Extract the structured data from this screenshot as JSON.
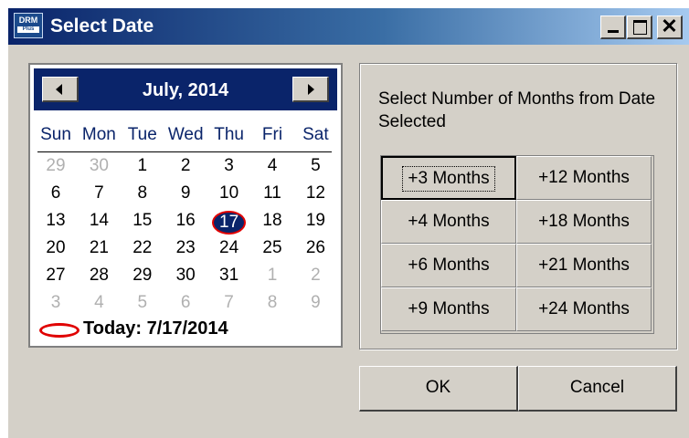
{
  "window": {
    "title": "Select Date",
    "app_icon_text": "DRM",
    "app_icon_subtext": "Plus",
    "close_glyph": "✕"
  },
  "calendar": {
    "month_year": "July, 2014",
    "weekdays": [
      "Sun",
      "Mon",
      "Tue",
      "Wed",
      "Thu",
      "Fri",
      "Sat"
    ],
    "weeks": [
      [
        "29",
        "30",
        "1",
        "2",
        "3",
        "4",
        "5"
      ],
      [
        "6",
        "7",
        "8",
        "9",
        "10",
        "11",
        "12"
      ],
      [
        "13",
        "14",
        "15",
        "16",
        "17",
        "18",
        "19"
      ],
      [
        "20",
        "21",
        "22",
        "23",
        "24",
        "25",
        "26"
      ],
      [
        "27",
        "28",
        "29",
        "30",
        "31",
        "1",
        "2"
      ],
      [
        "3",
        "4",
        "5",
        "6",
        "7",
        "8",
        "9"
      ]
    ],
    "selected_day": "17",
    "today_label": "Today: 7/17/2014"
  },
  "months_panel": {
    "label": "Select Number of Months from Date Selected",
    "buttons": [
      [
        "+3 Months",
        "+12 Months"
      ],
      [
        "+4 Months",
        "+18 Months"
      ],
      [
        "+6 Months",
        "+21 Months"
      ],
      [
        "+9 Months",
        "+24 Months"
      ]
    ]
  },
  "actions": {
    "ok": "OK",
    "cancel": "Cancel"
  },
  "colors": {
    "title_bar": "#0a246a",
    "calendar_header": "#0a246a",
    "annotation_red": "#e00000",
    "face": "#d4d0c8"
  }
}
